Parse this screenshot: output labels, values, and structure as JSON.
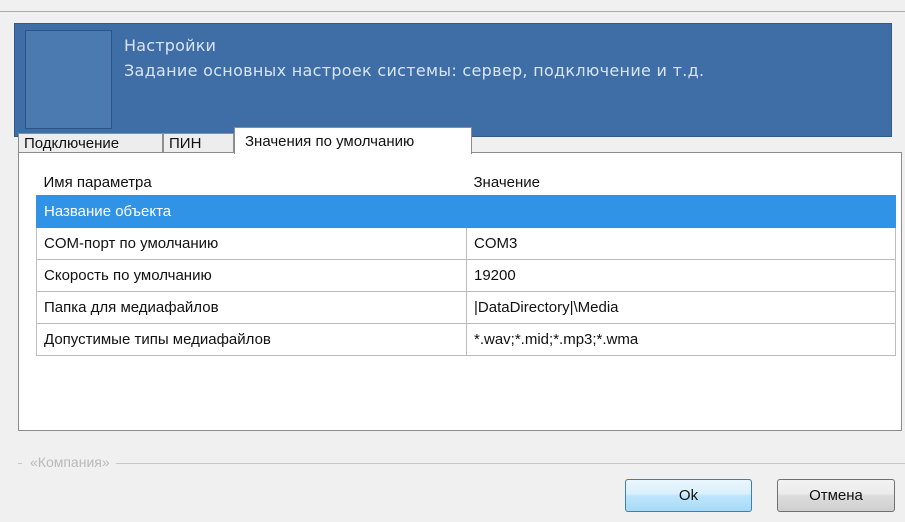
{
  "header": {
    "title": "Настройки",
    "subtitle": "Задание основных настроек системы: сервер, подключение и т.д."
  },
  "tabs": [
    {
      "label": "Подключение"
    },
    {
      "label": "ПИН"
    },
    {
      "label": "Значения по умолчанию",
      "active": true
    }
  ],
  "grid": {
    "columns": [
      "Имя параметра",
      "Значение"
    ],
    "rows": [
      {
        "name": "Название объекта",
        "value": "",
        "selected": true
      },
      {
        "name": "COM-порт по умолчанию",
        "value": "COM3"
      },
      {
        "name": "Скорость по умолчанию",
        "value": "19200"
      },
      {
        "name": "Папка для медиафайлов",
        "value": "|DataDirectory|\\Media"
      },
      {
        "name": "Допустимые типы медиафайлов",
        "value": "*.wav;*.mid;*.mp3;*.wma"
      }
    ]
  },
  "footer": {
    "company_label": "«Компания»",
    "ok_label": "Ok",
    "cancel_label": "Отмена"
  },
  "colors": {
    "header_bg": "#3f6ea6",
    "selection": "#3193e6"
  }
}
